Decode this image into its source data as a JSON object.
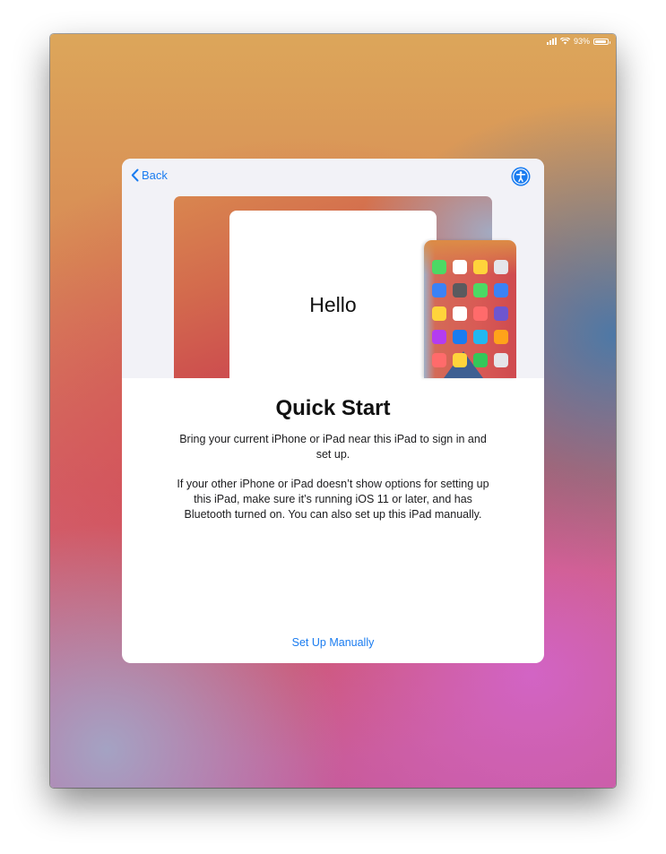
{
  "status_bar": {
    "battery_percent": "93%",
    "battery_level": 0.93
  },
  "nav": {
    "back_label": "Back"
  },
  "illustration": {
    "card_text": "Hello",
    "app_icon_colors": [
      "#4cd964",
      "#ffffff",
      "#ffd43b",
      "#e5e5ea",
      "#3b82f6",
      "#5a5a5e",
      "#4cd964",
      "#3b82f6",
      "#ffd43b",
      "#ffffff",
      "#ff6b6b",
      "#6e56cf",
      "#b43cf0",
      "#1a7cf0",
      "#22b8f0",
      "#ffa31a",
      "#ff6b6b",
      "#ffd43b",
      "#34c759",
      "#e5e5ea"
    ]
  },
  "main": {
    "title": "Quick Start",
    "paragraph1": "Bring your current iPhone or iPad near this iPad to sign in and set up.",
    "paragraph2": "If your other iPhone or iPad doesn’t show options for setting up this iPad, make sure it’s running iOS 11 or later, and has Bluetooth turned on. You can also set up this iPad manually."
  },
  "footer": {
    "setup_manually_label": "Set Up Manually"
  },
  "colors": {
    "accent": "#1a7cf0"
  }
}
